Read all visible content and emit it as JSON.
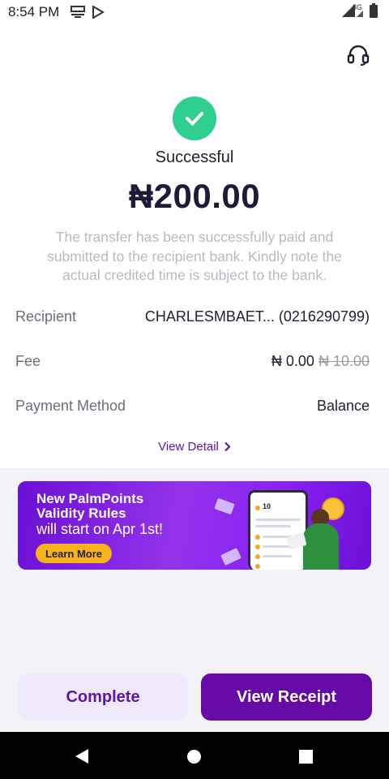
{
  "status_bar": {
    "time": "8:54 PM",
    "network": "3G"
  },
  "result": {
    "status": "Successful",
    "amount": "₦200.00",
    "message": "The transfer has been successfully paid and submitted to the recipient bank. Kindly note the actual credited time is subject to the bank."
  },
  "details": {
    "recipient_label": "Recipient",
    "recipient_value": "CHARLESMBAET... (0216290799)",
    "fee_label": "Fee",
    "fee_value": "₦ 0.00",
    "fee_original": "₦ 10.00",
    "method_label": "Payment Method",
    "method_value": "Balance",
    "view_detail": "View Detail"
  },
  "banner": {
    "title_line1": "New PalmPoints",
    "title_line2": "Validity Rules",
    "subtitle": "will start on Apr 1st!",
    "button": "Learn More",
    "phone_points": "10"
  },
  "actions": {
    "complete": "Complete",
    "view_receipt": "View Receipt"
  },
  "colors": {
    "accent": "#650aa6",
    "success": "#2fcf8f",
    "banner_button": "#f8b21b"
  }
}
